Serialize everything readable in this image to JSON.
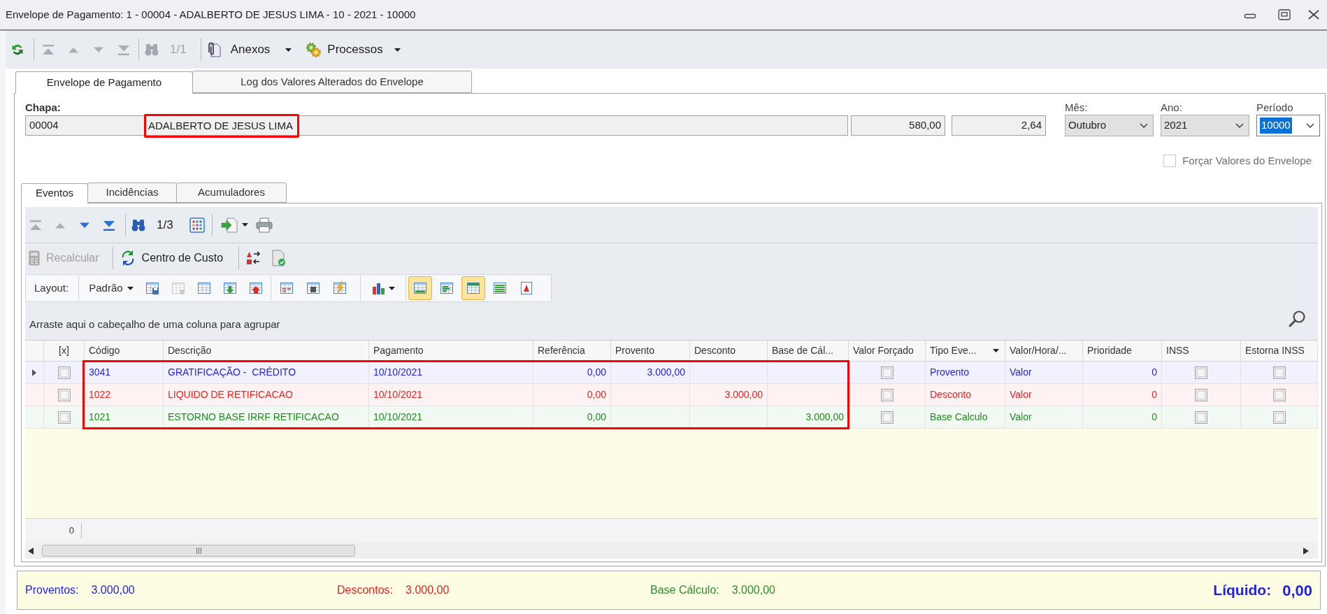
{
  "window": {
    "title": "Envelope de Pagamento: 1 - 00004 - ADALBERTO DE JESUS LIMA - 10 - 2021 - 10000"
  },
  "toolbar": {
    "navigation": [
      {
        "disabled": true
      },
      {
        "disabled": true
      },
      {
        "disabled": true
      },
      {
        "disabled": true
      }
    ],
    "find": {
      "disabled": true,
      "counter": "1/1"
    },
    "menus": [
      {
        "label": "Anexos"
      },
      {
        "label": "Processos"
      }
    ]
  },
  "tabs": [
    {
      "label": "Envelope de Pagamento",
      "selected": true
    },
    {
      "label": "Log dos Valores Alterados do Envelope",
      "selected": false
    }
  ],
  "header": {
    "label": "Chapa:",
    "fields": [
      {
        "kind": "text",
        "value": "00004",
        "highlighted": false
      },
      {
        "kind": "text",
        "value": "ADALBERTO DE JESUS LIMA",
        "highlighted": true
      },
      {
        "kind": "number",
        "value": "580,00",
        "highlighted": false
      },
      {
        "kind": "number",
        "value": "2,64",
        "highlighted": false
      }
    ],
    "selectors": [
      {
        "kind": "dropdown",
        "label": "Mês:",
        "value": "Outubro",
        "text_selected": false
      },
      {
        "kind": "dropdown",
        "label": "Ano:",
        "value": "2021",
        "text_selected": false
      },
      {
        "kind": "combobox",
        "label": "Período",
        "value": "10000",
        "text_selected": true
      }
    ],
    "force_values": {
      "label": "Forçar Valores do Envelope",
      "checked": false,
      "disabled": true
    }
  },
  "inner_tabs": [
    {
      "label": "Eventos",
      "selected": true
    },
    {
      "label": "Incidências",
      "selected": false
    },
    {
      "label": "Acumuladores",
      "selected": false
    }
  ],
  "grid_toolbar": {
    "navigation": [
      {
        "disabled": true
      },
      {
        "disabled": true
      },
      {
        "disabled": false
      },
      {
        "disabled": false
      }
    ],
    "find": {
      "disabled": false,
      "counter": "1/3"
    }
  },
  "actions": [
    {
      "label": "Recalcular",
      "disabled": true
    },
    {
      "label": "Centro de Custo",
      "disabled": false
    }
  ],
  "layout_bar": {
    "label": "Layout:",
    "preset": "Padrão",
    "tools": [
      {
        "disabled": false
      },
      {
        "disabled": true
      },
      {
        "disabled": false
      },
      {
        "disabled": false
      },
      {
        "disabled": false
      },
      {
        "disabled": false
      },
      {
        "disabled": false
      },
      {
        "disabled": false
      },
      {
        "disabled": false
      }
    ],
    "toggles": [
      {
        "selected": true
      },
      {
        "selected": false
      },
      {
        "selected": true
      },
      {
        "selected": false
      },
      {
        "selected": false
      }
    ]
  },
  "group_panel": {
    "hint": "Arraste aqui o cabeçalho de uma coluna para agrupar"
  },
  "grid": {
    "columns": [
      {
        "label": "[x]",
        "kind": "select",
        "highlighted": false,
        "filter_button": false
      },
      {
        "label": "Código",
        "kind": "text",
        "highlighted": true,
        "filter_button": false
      },
      {
        "label": "Descrição",
        "kind": "text",
        "highlighted": true,
        "filter_button": false
      },
      {
        "label": "Pagamento",
        "kind": "text",
        "highlighted": true,
        "filter_button": false
      },
      {
        "label": "Referência",
        "kind": "number",
        "highlighted": true,
        "filter_button": false
      },
      {
        "label": "Provento",
        "kind": "number",
        "highlighted": true,
        "filter_button": false
      },
      {
        "label": "Desconto",
        "kind": "number",
        "highlighted": true,
        "filter_button": false
      },
      {
        "label": "Base de Cál...",
        "kind": "number",
        "highlighted": true,
        "filter_button": false
      },
      {
        "label": "Valor Forçado",
        "kind": "check",
        "highlighted": false,
        "filter_button": false
      },
      {
        "label": "Tipo Eve...",
        "kind": "text",
        "highlighted": false,
        "filter_button": true
      },
      {
        "label": "Valor/Hora/...",
        "kind": "text",
        "highlighted": false,
        "filter_button": false
      },
      {
        "label": "Prioridade",
        "kind": "number",
        "highlighted": false,
        "filter_button": false
      },
      {
        "label": "INSS",
        "kind": "check",
        "highlighted": false,
        "filter_button": false
      },
      {
        "label": "Estorna INSS",
        "kind": "check",
        "highlighted": false,
        "filter_button": false
      }
    ],
    "rows": [
      {
        "color": "#2222e6",
        "current": true,
        "cells": [
          {
            "checked": false
          },
          "3041",
          "GRATIFICAÇÃO -  CRÉDITO",
          "10/10/2021",
          "0,00",
          "3.000,00",
          null,
          null,
          {
            "checked": false
          },
          "Provento",
          "Valor",
          "0",
          {
            "checked": false
          },
          {
            "checked": false
          }
        ]
      },
      {
        "color": "#ee2222",
        "current": false,
        "cells": [
          {
            "checked": false
          },
          "1022",
          "LIQUIDO DE RETIFICACAO",
          "10/10/2021",
          "0,00",
          null,
          "3.000,00",
          null,
          {
            "checked": false
          },
          "Desconto",
          "Valor",
          "0",
          {
            "checked": false
          },
          {
            "checked": false
          }
        ]
      },
      {
        "color": "#1e8c1e",
        "current": false,
        "cells": [
          {
            "checked": false
          },
          "1021",
          "ESTORNO BASE IRRF RETIFICACAO",
          "10/10/2021",
          "0,00",
          null,
          null,
          "3.000,00",
          {
            "checked": false
          },
          "Base Calculo",
          "Valor",
          "0",
          {
            "checked": false
          },
          {
            "checked": false
          }
        ]
      }
    ],
    "footer_count": "0"
  },
  "summary": {
    "items": [
      {
        "label": "Proventos:",
        "value": "3.000,00",
        "color": "#2323e8"
      },
      {
        "label": "Descontos:",
        "value": "3.000,00",
        "color": "#e02525"
      },
      {
        "label": "Base Cálculo:",
        "value": "3.000,00",
        "color": "#2e8b2e"
      }
    ],
    "total": {
      "label": "Líquido:",
      "value": "0,00"
    }
  }
}
